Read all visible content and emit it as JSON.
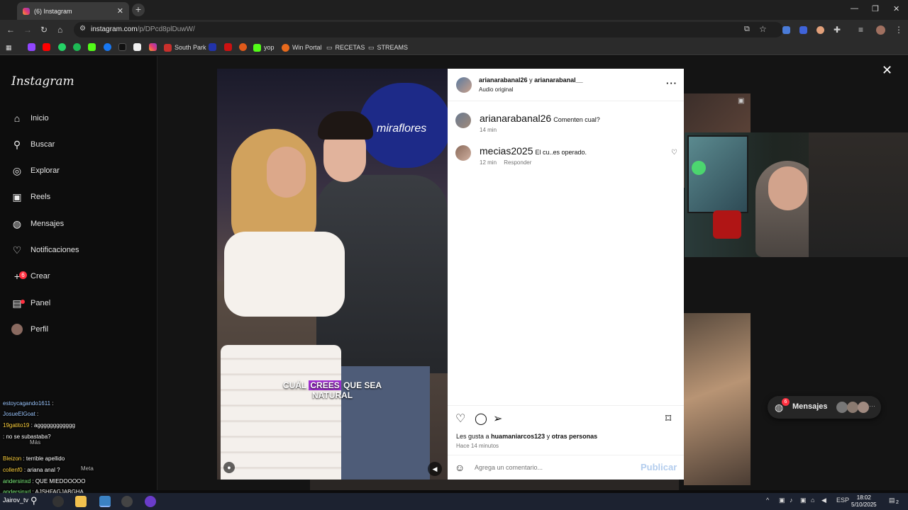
{
  "browser": {
    "tab_title": "(6) Instagram",
    "url_host": "instagram.com",
    "url_path": "/p/DPcd8plDuwW/",
    "bookmarks": [
      {
        "label": "South Park",
        "color": "#c9302c"
      },
      {
        "label": "yop",
        "color": "#e05a1a"
      },
      {
        "label": "Win Portal",
        "color": "#e86a1c"
      },
      {
        "label": "RECETAS",
        "color": "#cfcfcf"
      },
      {
        "label": "STREAMS",
        "color": "#cfcfcf"
      }
    ]
  },
  "sidebar": {
    "logo": "Instagram",
    "items": [
      {
        "label": "Inicio",
        "icon": "home-icon"
      },
      {
        "label": "Buscar",
        "icon": "search-icon"
      },
      {
        "label": "Explorar",
        "icon": "compass-icon"
      },
      {
        "label": "Reels",
        "icon": "reels-icon"
      },
      {
        "label": "Mensajes",
        "icon": "messenger-icon"
      },
      {
        "label": "Notificaciones",
        "icon": "heart-icon"
      },
      {
        "label": "Crear",
        "icon": "plus-icon"
      },
      {
        "label": "Panel",
        "icon": "chart-icon"
      },
      {
        "label": "Perfil",
        "icon": "avatar-icon"
      }
    ],
    "messages_badge": "6"
  },
  "post": {
    "authors_a": "arianarabanal26",
    "authors_join": "y",
    "authors_b": "arianarabanal__",
    "audio": "Audio original",
    "caption_pre": "CU",
    "caption_mid": "ÁL",
    "caption_hl": "CREES",
    "caption_post": "QUE SEA",
    "caption_line2": "NATURAL",
    "sign_text": "miraflores",
    "comments": [
      {
        "user": "arianarabanal26",
        "text": "Comenten cual?",
        "time": "14 min",
        "reply": ""
      },
      {
        "user": "mecias2025",
        "text": "El cu..es operado.",
        "time": "12 min",
        "reply": "Responder"
      }
    ],
    "likes_prefix": "Les gusta a",
    "likes_user": "huamaniarcos123",
    "likes_join": "y",
    "likes_rest": "otras personas",
    "posted_ago": "Hace 14 minutos",
    "comment_placeholder": "Agrega un comentario...",
    "publish_label": "Publicar"
  },
  "messages_pill": {
    "label": "Mensajes",
    "badge": "6"
  },
  "chat": [
    {
      "user": "estoycagando1611",
      "msg": ":",
      "color": "#9ec8ff"
    },
    {
      "user": "JosueElGoat",
      "msg": ":",
      "color": "#9ec8ff"
    },
    {
      "user": "19gatito19",
      "msg": ": agggggggggggg",
      "color": "#ffd23f"
    },
    {
      "user": "",
      "msg": ": no se subastaba?",
      "color": "#ff4d4d"
    },
    {
      "user": "Bleizon",
      "msg": ": terrible apellido",
      "color": "#ffd23f"
    },
    {
      "user": "collenf0",
      "msg": ": ariana anal ?",
      "color": "#ffd23f"
    },
    {
      "user": "andersinxd",
      "msg": ": QUE MIEDOOOOO",
      "color": "#7ef07e"
    },
    {
      "user": "andersinxd",
      "msg": ": AJSHFAGJABGHA",
      "color": "#7ef07e"
    }
  ],
  "chat_overlay_extra": {
    "mas": "Más",
    "meta": "Meta",
    "channel": "Jairov_tv"
  },
  "taskbar": {
    "lang": "ESP",
    "time": "18:02",
    "date": "5/10/2025",
    "notif": "2"
  }
}
